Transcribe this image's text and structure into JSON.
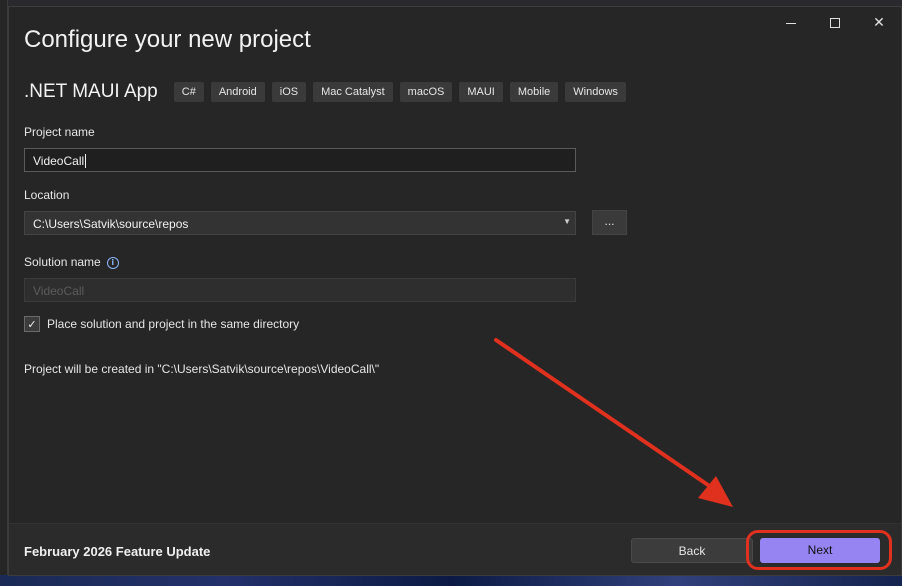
{
  "dialog": {
    "title": "Configure your new project",
    "window_controls": {
      "minimize": "—",
      "close": "✕"
    }
  },
  "template": {
    "name": ".NET MAUI App",
    "tags": [
      "C#",
      "Android",
      "iOS",
      "Mac Catalyst",
      "macOS",
      "MAUI",
      "Mobile",
      "Windows"
    ]
  },
  "form": {
    "project_name_label": "Project name",
    "project_name_value": "VideoCall",
    "location_label": "Location",
    "location_value": "C:\\Users\\Satvik\\source\\repos",
    "browse_label": "...",
    "solution_name_label": "Solution name",
    "solution_name_value": "VideoCall",
    "same_dir_label": "Place solution and project in the same directory",
    "same_dir_checked": true,
    "path_note": "Project will be created in \"C:\\Users\\Satvik\\source\\repos\\VideoCall\\\""
  },
  "footer": {
    "update_note": "February 2026 Feature Update",
    "back_label": "Back",
    "next_label": "Next"
  },
  "colors": {
    "accent": "#9684f2",
    "annotation": "#e0301e"
  },
  "icons": {
    "info": "info-icon",
    "dropdown": "chevron-down-icon",
    "check": "check-icon"
  }
}
